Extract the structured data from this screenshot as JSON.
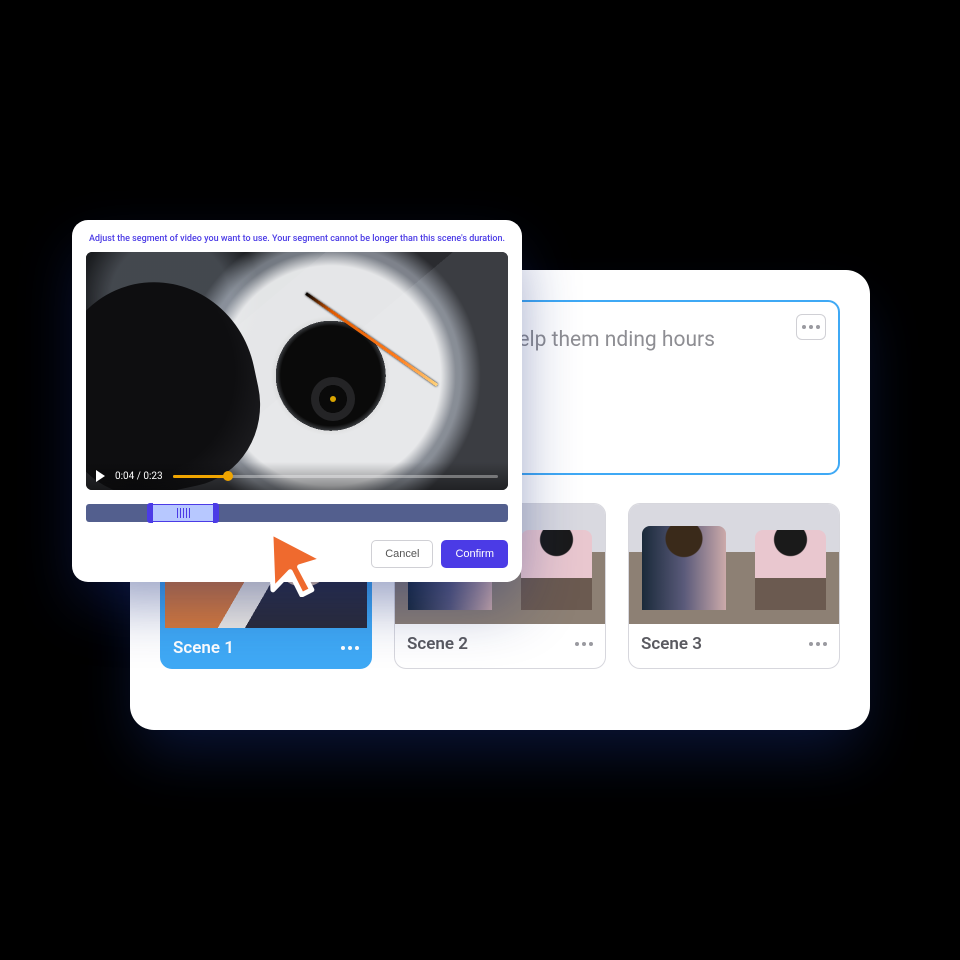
{
  "editor": {
    "body_text": "creators and digital power of AI to help them nding hours learning the g softwares.",
    "scenes": [
      {
        "label": "Scene 1",
        "selected": true
      },
      {
        "label": "Scene 2",
        "selected": false
      },
      {
        "label": "Scene 3",
        "selected": false
      }
    ]
  },
  "modal": {
    "instruction": "Adjust the segment of video you want to use. Your segment cannot be longer than this scene's duration.",
    "time_label": "0:04 / 0:23",
    "cancel_label": "Cancel",
    "confirm_label": "Confirm"
  }
}
